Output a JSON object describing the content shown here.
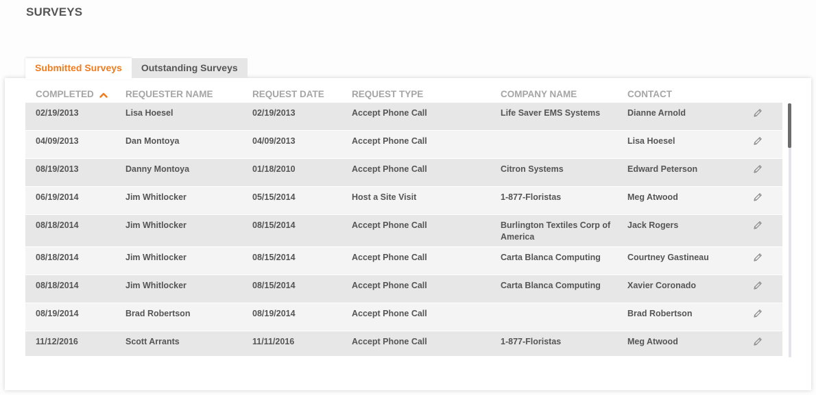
{
  "page": {
    "title": "SURVEYS"
  },
  "tabs": [
    {
      "label": "Submitted Surveys",
      "active": true
    },
    {
      "label": "Outstanding Surveys",
      "active": false
    }
  ],
  "colors": {
    "accent": "#f07c1e",
    "header_text": "#a5a5a5",
    "row_dark": "#e7e7e7",
    "row_light": "#f4f4f4",
    "text": "#555555"
  },
  "table": {
    "columns": [
      "COMPLETED",
      "REQUESTER NAME",
      "REQUEST DATE",
      "REQUEST TYPE",
      "COMPANY NAME",
      "CONTACT"
    ],
    "sort": {
      "column": "COMPLETED",
      "direction": "ascending",
      "icon": "chevron-up-icon"
    },
    "row_action_icon": "pencil-icon",
    "rows": [
      {
        "completed": "02/19/2013",
        "requester": "Lisa Hoesel",
        "request_date": "02/19/2013",
        "request_type": "Accept Phone Call",
        "company": "Life Saver EMS Systems",
        "contact": "Dianne Arnold"
      },
      {
        "completed": "04/09/2013",
        "requester": "Dan Montoya",
        "request_date": "04/09/2013",
        "request_type": "Accept Phone Call",
        "company": "",
        "contact": "Lisa Hoesel"
      },
      {
        "completed": "08/19/2013",
        "requester": "Danny Montoya",
        "request_date": "01/18/2010",
        "request_type": "Accept Phone Call",
        "company": "Citron Systems",
        "contact": "Edward Peterson"
      },
      {
        "completed": "06/19/2014",
        "requester": "Jim Whitlocker",
        "request_date": "05/15/2014",
        "request_type": "Host a Site Visit",
        "company": "1-877-Floristas",
        "contact": "Meg Atwood"
      },
      {
        "completed": "08/18/2014",
        "requester": "Jim Whitlocker",
        "request_date": "08/15/2014",
        "request_type": "Accept Phone Call",
        "company": "Burlington Textiles Corp of America",
        "contact": "Jack Rogers"
      },
      {
        "completed": "08/18/2014",
        "requester": "Jim Whitlocker",
        "request_date": "08/15/2014",
        "request_type": "Accept Phone Call",
        "company": "Carta Blanca Computing",
        "contact": "Courtney Gastineau"
      },
      {
        "completed": "08/18/2014",
        "requester": "Jim Whitlocker",
        "request_date": "08/15/2014",
        "request_type": "Accept Phone Call",
        "company": "Carta Blanca Computing",
        "contact": "Xavier Coronado"
      },
      {
        "completed": "08/19/2014",
        "requester": "Brad Robertson",
        "request_date": "08/19/2014",
        "request_type": "Accept Phone Call",
        "company": "",
        "contact": "Brad Robertson"
      },
      {
        "completed": "11/12/2016",
        "requester": "Scott Arrants",
        "request_date": "11/11/2016",
        "request_type": "Accept Phone Call",
        "company": "1-877-Floristas",
        "contact": "Meg Atwood"
      }
    ]
  }
}
